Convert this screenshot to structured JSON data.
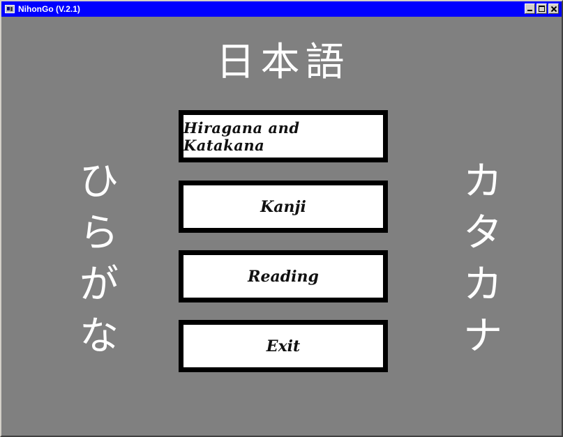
{
  "window": {
    "title": "NihonGo (V.2.1)",
    "controls": {
      "minimize_icon": "minimize-icon",
      "maximize_icon": "maximize-icon",
      "close_icon": "close-icon"
    }
  },
  "main": {
    "heading": "日本語",
    "hiragana": [
      "ひ",
      "ら",
      "が",
      "な"
    ],
    "katakana": [
      "カ",
      "タ",
      "カ",
      "ナ"
    ],
    "buttons": {
      "hiragana_katakana": "Hiragana and Katakana",
      "kanji": "Kanji",
      "reading": "Reading",
      "exit": "Exit"
    }
  },
  "colors": {
    "background": "#808080",
    "titlebar": "#0000ff",
    "button_border": "#000000",
    "button_fill": "#ffffff"
  }
}
